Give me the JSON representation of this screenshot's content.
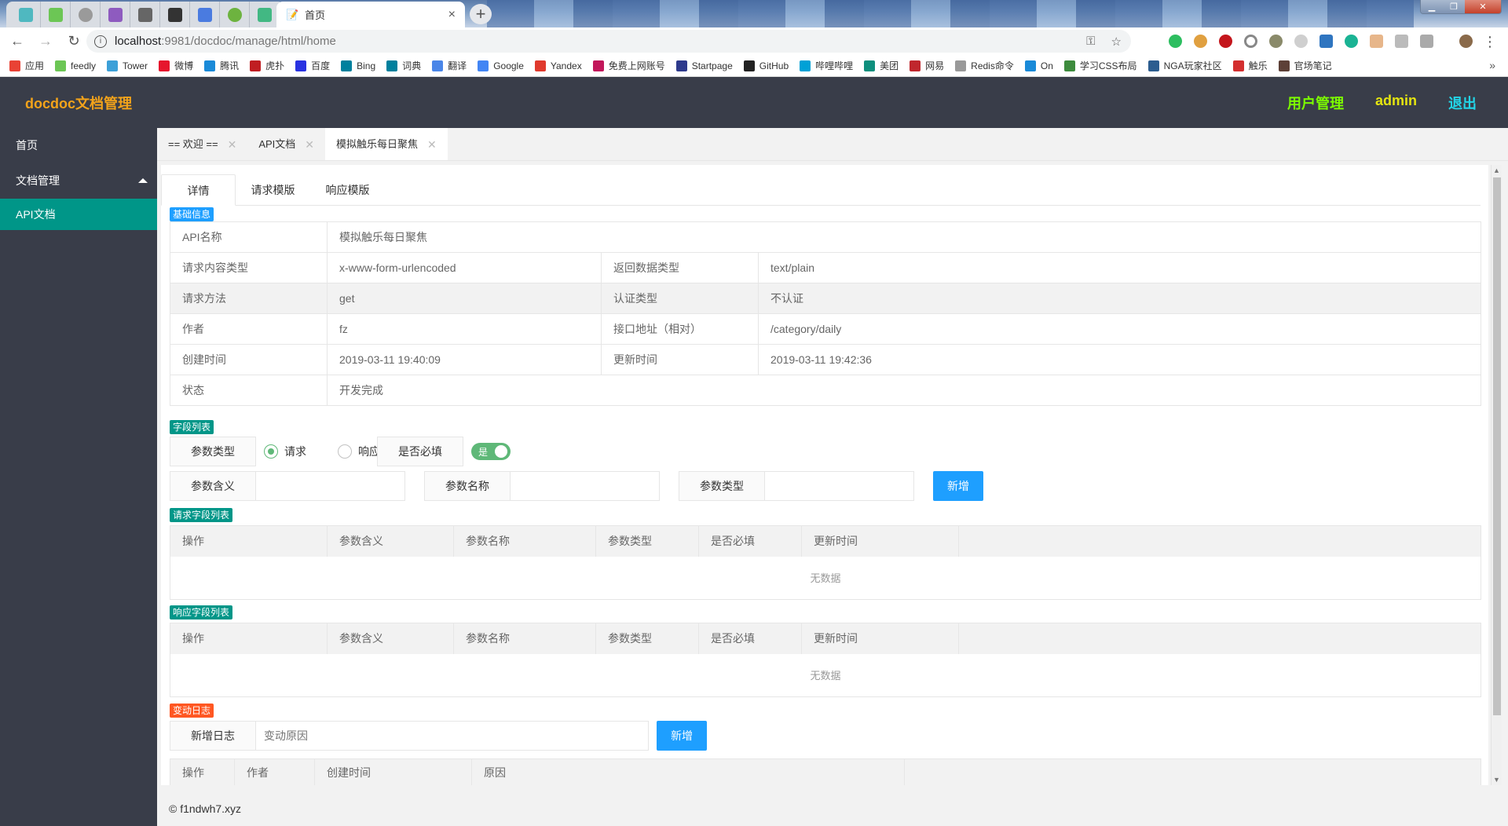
{
  "browser": {
    "pinned_tabs": [
      {
        "icon": "lightbulb-icon",
        "color": "#4fb8c0"
      },
      {
        "icon": "feedly-icon",
        "color": "#6cc655"
      },
      {
        "icon": "circle-logo-icon",
        "color": "#9a9a9a"
      },
      {
        "icon": "vs-icon",
        "color": "#8e5bbf"
      },
      {
        "icon": "book-icon",
        "color": "#666666"
      },
      {
        "icon": "translate-icon",
        "color": "#333333"
      },
      {
        "icon": "baidu-icon",
        "color": "#4a7be0"
      },
      {
        "icon": "spring-icon",
        "color": "#6db33f"
      },
      {
        "icon": "vue-icon",
        "color": "#42b883"
      }
    ],
    "active_tab": {
      "title": "首页",
      "icon": "page-icon"
    },
    "new_tab_label": "+",
    "url_host": "localhost",
    "url_rest": ":9981/docdoc/manage/html/home",
    "bookmarks": [
      {
        "label": "应用",
        "color": "#e94235"
      },
      {
        "label": "feedly",
        "color": "#6cc655"
      },
      {
        "label": "Tower",
        "color": "#3ca0d8"
      },
      {
        "label": "微博",
        "color": "#e6162d"
      },
      {
        "label": "腾讯",
        "color": "#1a8ad8"
      },
      {
        "label": "虎扑",
        "color": "#c01e22"
      },
      {
        "label": "百度",
        "color": "#2932e1"
      },
      {
        "label": "Bing",
        "color": "#00809d"
      },
      {
        "label": "词典",
        "color": "#00809d"
      },
      {
        "label": "翻译",
        "color": "#4a86e8"
      },
      {
        "label": "Google",
        "color": "#4285f4"
      },
      {
        "label": "Yandex",
        "color": "#e03a2d"
      },
      {
        "label": "免费上网账号",
        "color": "#c2185b"
      },
      {
        "label": "Startpage",
        "color": "#2e3a8c"
      },
      {
        "label": "GitHub",
        "color": "#222222"
      },
      {
        "label": "哔哩哔哩",
        "color": "#00a1d6"
      },
      {
        "label": "美团",
        "color": "#0e8f7d"
      },
      {
        "label": "网易",
        "color": "#c0272d"
      },
      {
        "label": "Redis命令",
        "color": "#999999"
      },
      {
        "label": "On",
        "color": "#1a8ad8"
      },
      {
        "label": "学习CSS布局",
        "color": "#3d8b3d"
      },
      {
        "label": "NGA玩家社区",
        "color": "#2c5d8f"
      },
      {
        "label": "触乐",
        "color": "#d32f2f"
      },
      {
        "label": "官场笔记",
        "color": "#5d4037"
      }
    ]
  },
  "app": {
    "logo": "docdoc文档管理",
    "header_links": [
      {
        "label": "用户管理",
        "color": "#7cfc00"
      },
      {
        "label": "admin",
        "color": "#e5e510"
      },
      {
        "label": "退出",
        "color": "#22d6e8"
      }
    ],
    "sidebar": {
      "home": "首页",
      "group": "文档管理",
      "active_sub": "API文档"
    },
    "page_tabs": [
      {
        "label": "== 欢迎 ==",
        "active": false
      },
      {
        "label": "API文档",
        "active": false
      },
      {
        "label": "模拟触乐每日聚焦",
        "active": true
      }
    ],
    "inner_tabs": [
      "详情",
      "请求模版",
      "响应模版"
    ],
    "sections": {
      "basic": "基础信息",
      "fields": "字段列表",
      "request_fields": "请求字段列表",
      "response_fields": "响应字段列表",
      "changelog": "变动日志"
    },
    "basic_info": {
      "api_name_label": "API名称",
      "api_name": "模拟触乐每日聚焦",
      "content_type_label": "请求内容类型",
      "content_type": "x-www-form-urlencoded",
      "return_type_label": "返回数据类型",
      "return_type": "text/plain",
      "method_label": "请求方法",
      "method": "get",
      "auth_label": "认证类型",
      "auth": "不认证",
      "author_label": "作者",
      "author": "fz",
      "path_label": "接口地址（相对）",
      "path": "/category/daily",
      "created_label": "创建时间",
      "created": "2019-03-11 19:40:09",
      "updated_label": "更新时间",
      "updated": "2019-03-11 19:42:36",
      "status_label": "状态",
      "status": "开发完成"
    },
    "field_form": {
      "param_type_label": "参数类型",
      "radio_request": "请求",
      "radio_response": "响应",
      "selected": "请求",
      "required_label": "是否必填",
      "required_switch": "是",
      "meaning_label": "参数含义",
      "name_label": "参数名称",
      "type_label": "参数类型",
      "add_button": "新增"
    },
    "field_table_headers": [
      "操作",
      "参数含义",
      "参数名称",
      "参数类型",
      "是否必填",
      "更新时间"
    ],
    "empty_text": "无数据",
    "log_form": {
      "label": "新增日志",
      "placeholder": "变动原因",
      "add_button": "新增"
    },
    "log_table_headers": [
      "操作",
      "作者",
      "创建时间",
      "原因"
    ],
    "footer": "© f1ndwh7.xyz"
  }
}
